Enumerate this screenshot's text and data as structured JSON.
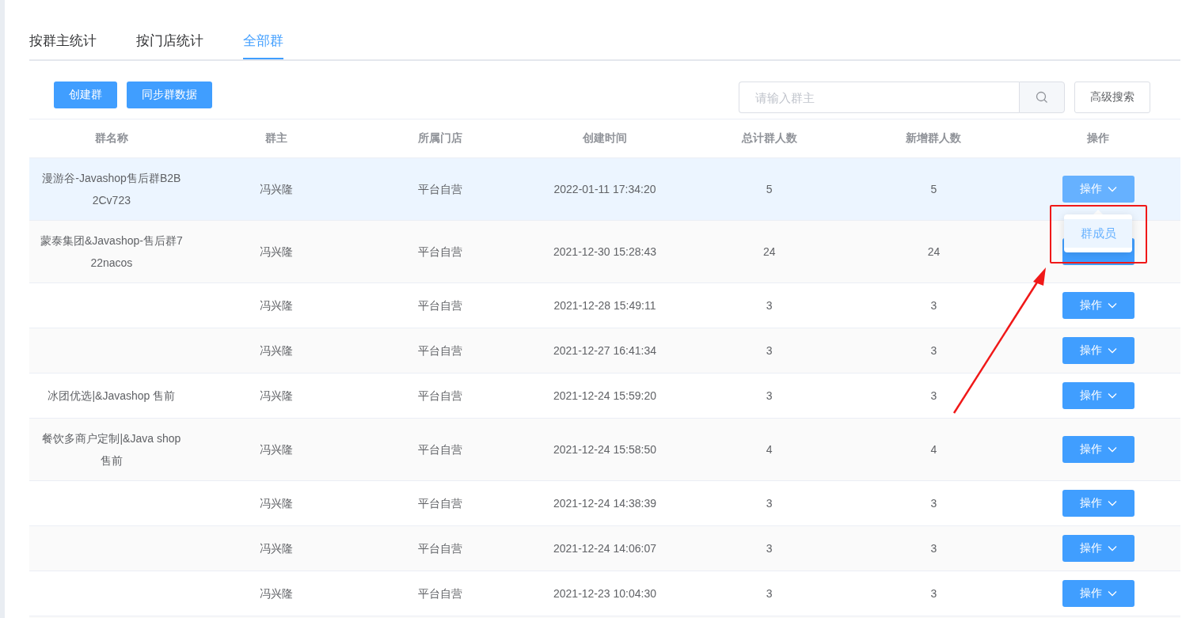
{
  "tabs": [
    {
      "label": "按群主统计",
      "selected": false
    },
    {
      "label": "按门店统计",
      "selected": false
    },
    {
      "label": "全部群",
      "selected": true
    }
  ],
  "toolbar": {
    "buttons": [
      "创建群",
      "同步群数据"
    ],
    "search": {
      "placeholder": "请输入群主"
    },
    "advanced_search": "高级搜索"
  },
  "table": {
    "columns": [
      "群名称",
      "群主",
      "所属门店",
      "创建时间",
      "总计群人数",
      "新增群人数",
      "操作"
    ],
    "rows": [
      {
        "name": "漫游谷-Javashop售后群B2B2Cv723",
        "owner": "冯兴隆",
        "store": "平台自营",
        "created": "2022-01-11 17:34:20",
        "total": "5",
        "new": "5",
        "action": "操作",
        "hovered": true,
        "menu_open": true
      },
      {
        "name": "蒙泰集团&Javashop-售后群722nacos",
        "owner": "冯兴隆",
        "store": "平台自营",
        "created": "2021-12-30 15:28:43",
        "total": "24",
        "new": "24",
        "hovered": false,
        "menu_open": false
      },
      {
        "owner": "冯兴隆",
        "store": "平台自营",
        "created": "2021-12-28 15:49:11",
        "total": "3",
        "new": "3",
        "action": "操作",
        "hovered": false,
        "menu_open": false
      },
      {
        "owner": "冯兴隆",
        "store": "平台自营",
        "created": "2021-12-27 16:41:34",
        "total": "3",
        "new": "3",
        "action": "操作",
        "hovered": false,
        "menu_open": false
      },
      {
        "name": "冰团优选|&Javashop 售前",
        "owner": "冯兴隆",
        "store": "平台自营",
        "created": "2021-12-24 15:59:20",
        "total": "3",
        "new": "3",
        "action": "操作",
        "hovered": false,
        "menu_open": false
      },
      {
        "name": "餐饮多商户定制|&Java shop售前",
        "owner": "冯兴隆",
        "store": "平台自营",
        "created": "2021-12-24 15:58:50",
        "total": "4",
        "new": "4",
        "action": "操作",
        "hovered": false,
        "menu_open": false
      },
      {
        "owner": "冯兴隆",
        "store": "平台自营",
        "created": "2021-12-24 14:38:39",
        "total": "3",
        "new": "3",
        "action": "操作",
        "hovered": false,
        "menu_open": false
      },
      {
        "owner": "冯兴隆",
        "store": "平台自营",
        "created": "2021-12-24 14:06:07",
        "total": "3",
        "new": "3",
        "action": "操作",
        "hovered": false,
        "menu_open": false
      },
      {
        "owner": "冯兴隆",
        "store": "平台自营",
        "created": "2021-12-23 10:04:30",
        "total": "3",
        "new": "3",
        "action": "操作",
        "hovered": false,
        "menu_open": false
      }
    ]
  },
  "dropdown_menu": {
    "items": [
      {
        "label": "群成员",
        "hovered": true
      }
    ]
  },
  "annotations": [
    {
      "kind": "frame"
    },
    {
      "kind": "arrow"
    }
  ]
}
